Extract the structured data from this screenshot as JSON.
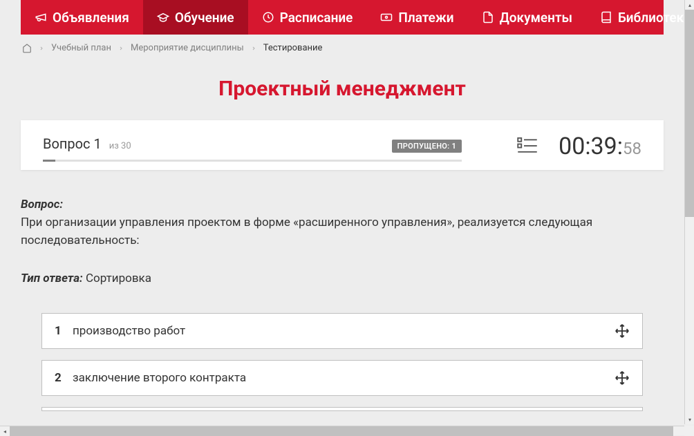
{
  "nav": {
    "items": [
      {
        "label": "Объявления",
        "icon": "megaphone"
      },
      {
        "label": "Обучение",
        "icon": "graduation",
        "active": true
      },
      {
        "label": "Расписание",
        "icon": "clock"
      },
      {
        "label": "Платежи",
        "icon": "payment"
      },
      {
        "label": "Документы",
        "icon": "document"
      },
      {
        "label": "Библиотека",
        "icon": "book",
        "dropdown": true
      }
    ]
  },
  "breadcrumb": {
    "items": [
      {
        "label": "Учебный план"
      },
      {
        "label": "Мероприятие дисциплины"
      }
    ],
    "current": "Тестирование"
  },
  "page_title": "Проектный менеджмент",
  "quiz": {
    "question_word": "Вопрос",
    "question_num": "1",
    "of_word": "из",
    "total": "30",
    "skipped_label": "ПРОПУЩЕНО: 1",
    "timer_main": "00:39:",
    "timer_seconds": "58"
  },
  "question": {
    "label": "Вопрос:",
    "text": "При организации управления проектом в форме «расширенного управления», реализуется следующая последовательность:",
    "answer_type_label": "Тип ответа:",
    "answer_type": "Сортировка"
  },
  "sort_items": [
    {
      "num": "1",
      "text": "производство работ"
    },
    {
      "num": "2",
      "text": "заключение второго контракта"
    }
  ]
}
